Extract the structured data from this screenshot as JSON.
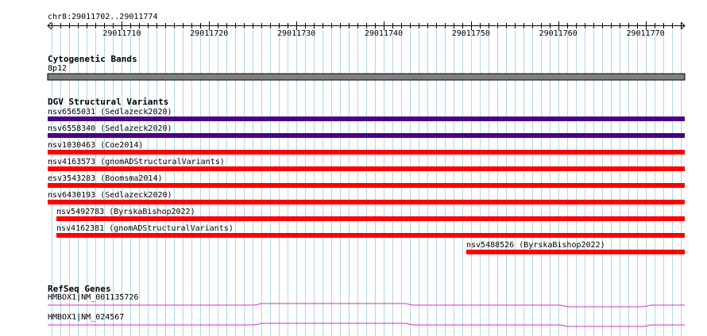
{
  "ruler": {
    "range_label": "chr8:29011702..29011774",
    "start": 29011702,
    "end": 29011774,
    "tick_labels": [
      "29011710",
      "29011720",
      "29011730",
      "29011740",
      "29011750",
      "29011760",
      "29011770"
    ]
  },
  "cytoband": {
    "title": "Cytogenetic Bands",
    "band": "8p12",
    "color": "#808080"
  },
  "dgv": {
    "title": "DGV Structural Variants",
    "features": [
      {
        "label": "nsv6565031 (Sedlazeck2020)",
        "start": 29011702,
        "end": 29011774,
        "color": "#4b0082"
      },
      {
        "label": "nsv6558340 (Sedlazeck2020)",
        "start": 29011702,
        "end": 29011774,
        "color": "#4b0082"
      },
      {
        "label": "nsv1030463 (Coe2014)",
        "start": 29011702,
        "end": 29011774,
        "color": "#ff0000"
      },
      {
        "label": "nsv4163573 (gnomADStructuralVariants)",
        "start": 29011702,
        "end": 29011774,
        "color": "#ff0000"
      },
      {
        "label": "esv3543283 (Boomsma2014)",
        "start": 29011702,
        "end": 29011774,
        "color": "#ff0000"
      },
      {
        "label": "nsv6430193 (Sedlazeck2020)",
        "start": 29011702,
        "end": 29011774,
        "color": "#ff0000"
      },
      {
        "label": "nsv5492783 (ByrskaBishop2022)",
        "start": 29011703,
        "end": 29011774,
        "color": "#ff0000"
      },
      {
        "label": "nsv4162381 (gnomADStructuralVariants)",
        "start": 29011703,
        "end": 29011774,
        "color": "#ff0000"
      },
      {
        "label": "nsv5488526 (ByrskaBishop2022)",
        "start": 29011750,
        "end": 29011774,
        "color": "#ff0000"
      }
    ]
  },
  "refseq": {
    "title": "RefSeq Genes",
    "transcripts": [
      {
        "label": "HMBOX1|NM_001135726",
        "color": "#cc33cc"
      },
      {
        "label": "HMBOX1|NM_024567",
        "color": "#cc33cc"
      }
    ]
  },
  "colors": {
    "gridline": "#add8e6",
    "ruler": "#000000"
  }
}
